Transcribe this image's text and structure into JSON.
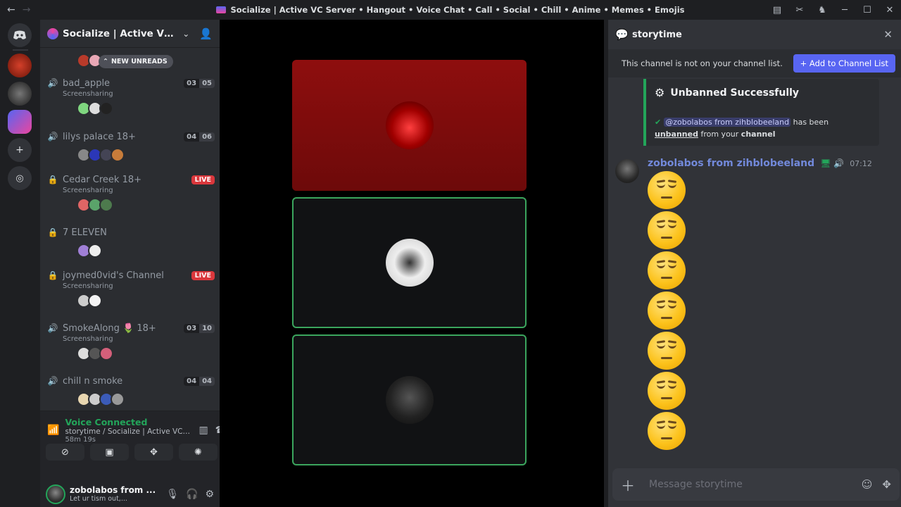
{
  "window": {
    "title": "Socialize | Active VC Server • Hangout • Voice Chat • Call • Social • Chill • Anime • Memes • Emojis",
    "back_glyph": "←",
    "forward_glyph": "→",
    "minimize_glyph": "─",
    "maximize_glyph": "☐",
    "close_glyph": "✕"
  },
  "server": {
    "name": "Socialize | Active VC Ser...",
    "unreads_label": "NEW UNREADS"
  },
  "voice_channels": [
    {
      "name": "bad_apple",
      "sub": "Screensharing",
      "count_a": "03",
      "count_b": "05",
      "live": ""
    },
    {
      "name": "lilys palace 18+",
      "sub": "",
      "count_a": "04",
      "count_b": "06",
      "live": ""
    },
    {
      "name": "Cedar Creek 18+",
      "sub": "Screensharing",
      "count_a": "",
      "count_b": "",
      "live": "LIVE"
    },
    {
      "name": "7 ELEVEN",
      "sub": "",
      "count_a": "",
      "count_b": "",
      "live": ""
    },
    {
      "name": "joymed0vid's Channel",
      "sub": "Screensharing",
      "count_a": "",
      "count_b": "",
      "live": "LIVE"
    },
    {
      "name": "SmokeAlong 🌷 18+",
      "sub": "Screensharing",
      "count_a": "03",
      "count_b": "10",
      "live": ""
    },
    {
      "name": "chill n smoke",
      "sub": "",
      "count_a": "04",
      "count_b": "04",
      "live": ""
    }
  ],
  "voice_panel": {
    "status": "Voice Connected",
    "location": "storytime / Socialize | Active VC Serv...",
    "elapsed": "58m 19s"
  },
  "user": {
    "name": "zobolabos from ...",
    "status": "Let ur tism out,..."
  },
  "chat": {
    "channel": "storytime",
    "notice": "This channel is not on your channel list.",
    "add_button": "Add to Channel List",
    "embed_title": "Unbanned Successfully",
    "embed_mention": "@zobolabos from zihblobeeland",
    "embed_text_1": " has been",
    "embed_word_unbanned": "unbanned",
    "embed_text_2": " from your ",
    "embed_word_channel": "channel",
    "author": "zobolabos from zihblobeeland",
    "time": "07:12",
    "emoji_name": "relieved-face",
    "emoji_count": 7,
    "placeholder": "Message storytime"
  },
  "colors": {
    "accent": "#5865f2",
    "speaking": "#23a55a",
    "live": "#da373c",
    "tile_red": "#8b0d0d"
  }
}
